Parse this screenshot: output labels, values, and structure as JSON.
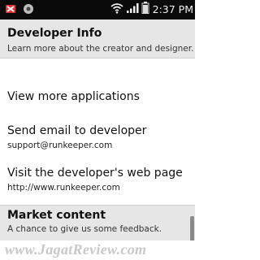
{
  "status_bar": {
    "time": "2:37 PM",
    "icons": [
      "notification-x-icon",
      "media-icon",
      "wifi-icon",
      "signal-icon",
      "battery-icon"
    ]
  },
  "developer_info": {
    "title": "Developer Info",
    "description": "Learn more about the creator and designer."
  },
  "items": [
    {
      "title": "View more applications"
    },
    {
      "title": "Send email to developer",
      "subtitle": "support@runkeeper.com"
    },
    {
      "title": "Visit the developer's web page",
      "subtitle": "http://www.runkeeper.com"
    }
  ],
  "market_content": {
    "title": "Market content",
    "description": "A chance to give us some feedback."
  },
  "watermark": "www.JagatReview.com"
}
